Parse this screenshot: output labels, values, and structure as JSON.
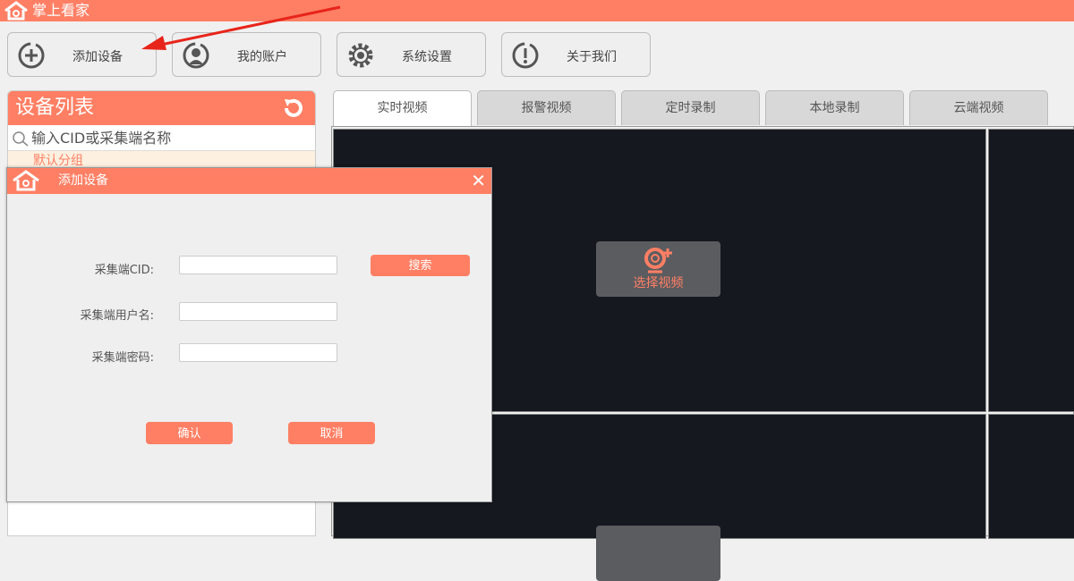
{
  "app": {
    "title": "掌上看家"
  },
  "toolbar": [
    {
      "label": "添加设备",
      "icon": "add-circle-icon"
    },
    {
      "label": "我的账户",
      "icon": "user-icon"
    },
    {
      "label": "系统设置",
      "icon": "gear-icon"
    },
    {
      "label": "关于我们",
      "icon": "info-icon"
    }
  ],
  "sidebar": {
    "title": "设备列表",
    "search_placeholder": "输入CID或采集端名称",
    "group": "默认分组"
  },
  "tabs": [
    "实时视频",
    "报警视频",
    "定时录制",
    "本地录制",
    "云端视频"
  ],
  "video": {
    "select_label": "选择视频"
  },
  "dialog": {
    "title": "添加设备",
    "cid_label": "采集端CID:",
    "user_label": "采集端用户名:",
    "pwd_label": "采集端密码:",
    "search": "搜索",
    "confirm": "确认",
    "cancel": "取消",
    "cid_value": "",
    "user_value": "",
    "pwd_value": ""
  },
  "colors": {
    "accent": "#ff7f64",
    "video_bg": "#15181f"
  }
}
